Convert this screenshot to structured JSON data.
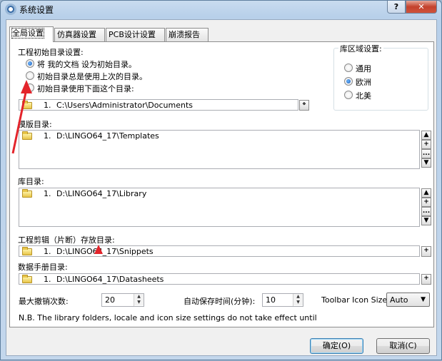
{
  "window": {
    "title": "系统设置",
    "help_glyph": "?",
    "close_glyph": "✕"
  },
  "tabs": [
    {
      "label": "全局设置",
      "active": true
    },
    {
      "label": "仿真器设置",
      "active": false
    },
    {
      "label": "PCB设计设置",
      "active": false
    },
    {
      "label": "崩溃报告",
      "active": false
    }
  ],
  "project_dir": {
    "group_label": "工程初始目录设置:",
    "options": [
      {
        "label": "将 我的文档 设为初始目录。",
        "checked": true
      },
      {
        "label": "初始目录总是使用上次的目录。",
        "checked": false
      },
      {
        "label": "初始目录使用下面这个目录:",
        "checked": false
      }
    ],
    "entry": {
      "num": "1.",
      "path": "C:\\Users\\Administrator\\Documents"
    },
    "browse_glyph": "⋄"
  },
  "locale": {
    "group_label": "库区域设置:",
    "options": [
      {
        "label": "通用",
        "checked": false
      },
      {
        "label": "欧洲",
        "checked": true
      },
      {
        "label": "北美",
        "checked": false
      }
    ]
  },
  "template_dir": {
    "label": "模版目录:",
    "entry": {
      "num": "1.",
      "path": "D:\\LINGO64_17\\Templates"
    }
  },
  "library_dir": {
    "label": "库目录:",
    "entry": {
      "num": "1.",
      "path": "D:\\LINGO64_17\\Library"
    }
  },
  "snippets_dir": {
    "label": "工程剪辑（片断）存放目录:",
    "entry": {
      "num": "1.",
      "path": "D:\\LINGO64_17\\Snippets"
    }
  },
  "datasheets_dir": {
    "label": "数据手册目录:",
    "entry": {
      "num": "1.",
      "path": "D:\\LINGO64_17\\Datasheets"
    }
  },
  "list_buttons": {
    "up": "▲",
    "add": "+",
    "edit": "...",
    "down": "▼"
  },
  "undo": {
    "label": "最大撤销次数:",
    "value": "20"
  },
  "autosave": {
    "label": "自动保存时间(分钟):",
    "value": "10"
  },
  "toolbar_icon": {
    "label": "Toolbar Icon Size:",
    "value": "Auto"
  },
  "note": "N.B. The library folders, locale and icon size settings do not take effect until Proteus is res",
  "buttons": {
    "ok": "确定(O)",
    "cancel": "取消(C)"
  },
  "annotation_color": "#e3242b"
}
